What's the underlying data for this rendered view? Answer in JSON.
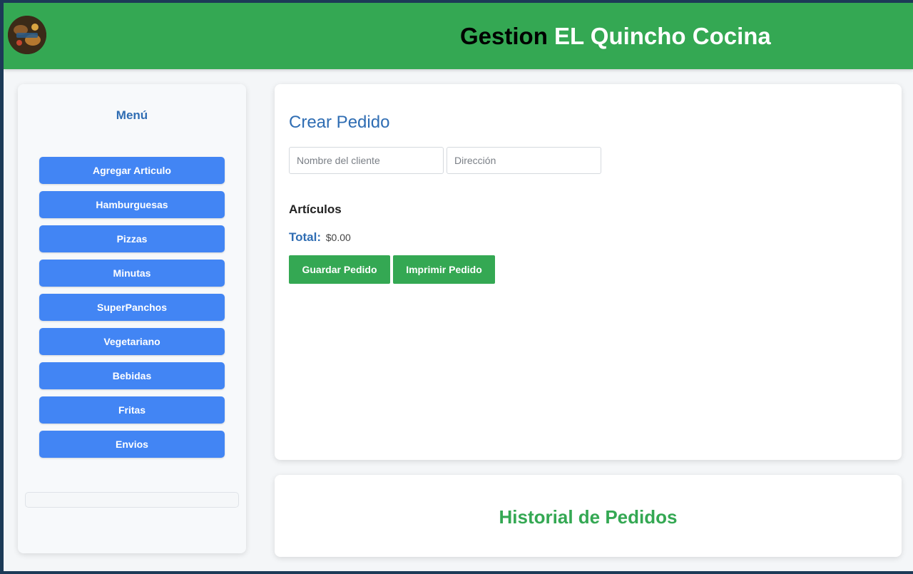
{
  "header": {
    "logo_icon": "restaurant-logo-icon",
    "title_part1": "Gestion ",
    "title_part2": "EL Quincho Cocina",
    "background": "#34a853"
  },
  "sidebar": {
    "title": "Menú",
    "items": [
      {
        "label": "Agregar Articulo"
      },
      {
        "label": "Hamburguesas"
      },
      {
        "label": "Pizzas"
      },
      {
        "label": "Minutas"
      },
      {
        "label": "SuperPanchos"
      },
      {
        "label": "Vegetariano"
      },
      {
        "label": "Bebidas"
      },
      {
        "label": "Fritas"
      },
      {
        "label": "Envios"
      }
    ],
    "button_color": "#4285f4"
  },
  "order": {
    "title": "Crear Pedido",
    "name_placeholder": "Nombre del cliente",
    "address_placeholder": "Dirección",
    "articles_label": "Artículos",
    "total_label": "Total:",
    "total_value": "$0.00",
    "save_label": "Guardar Pedido",
    "print_label": "Imprimir Pedido",
    "accent": "#2f6db3"
  },
  "history": {
    "title": "Historial de Pedidos",
    "color": "#34a853"
  }
}
